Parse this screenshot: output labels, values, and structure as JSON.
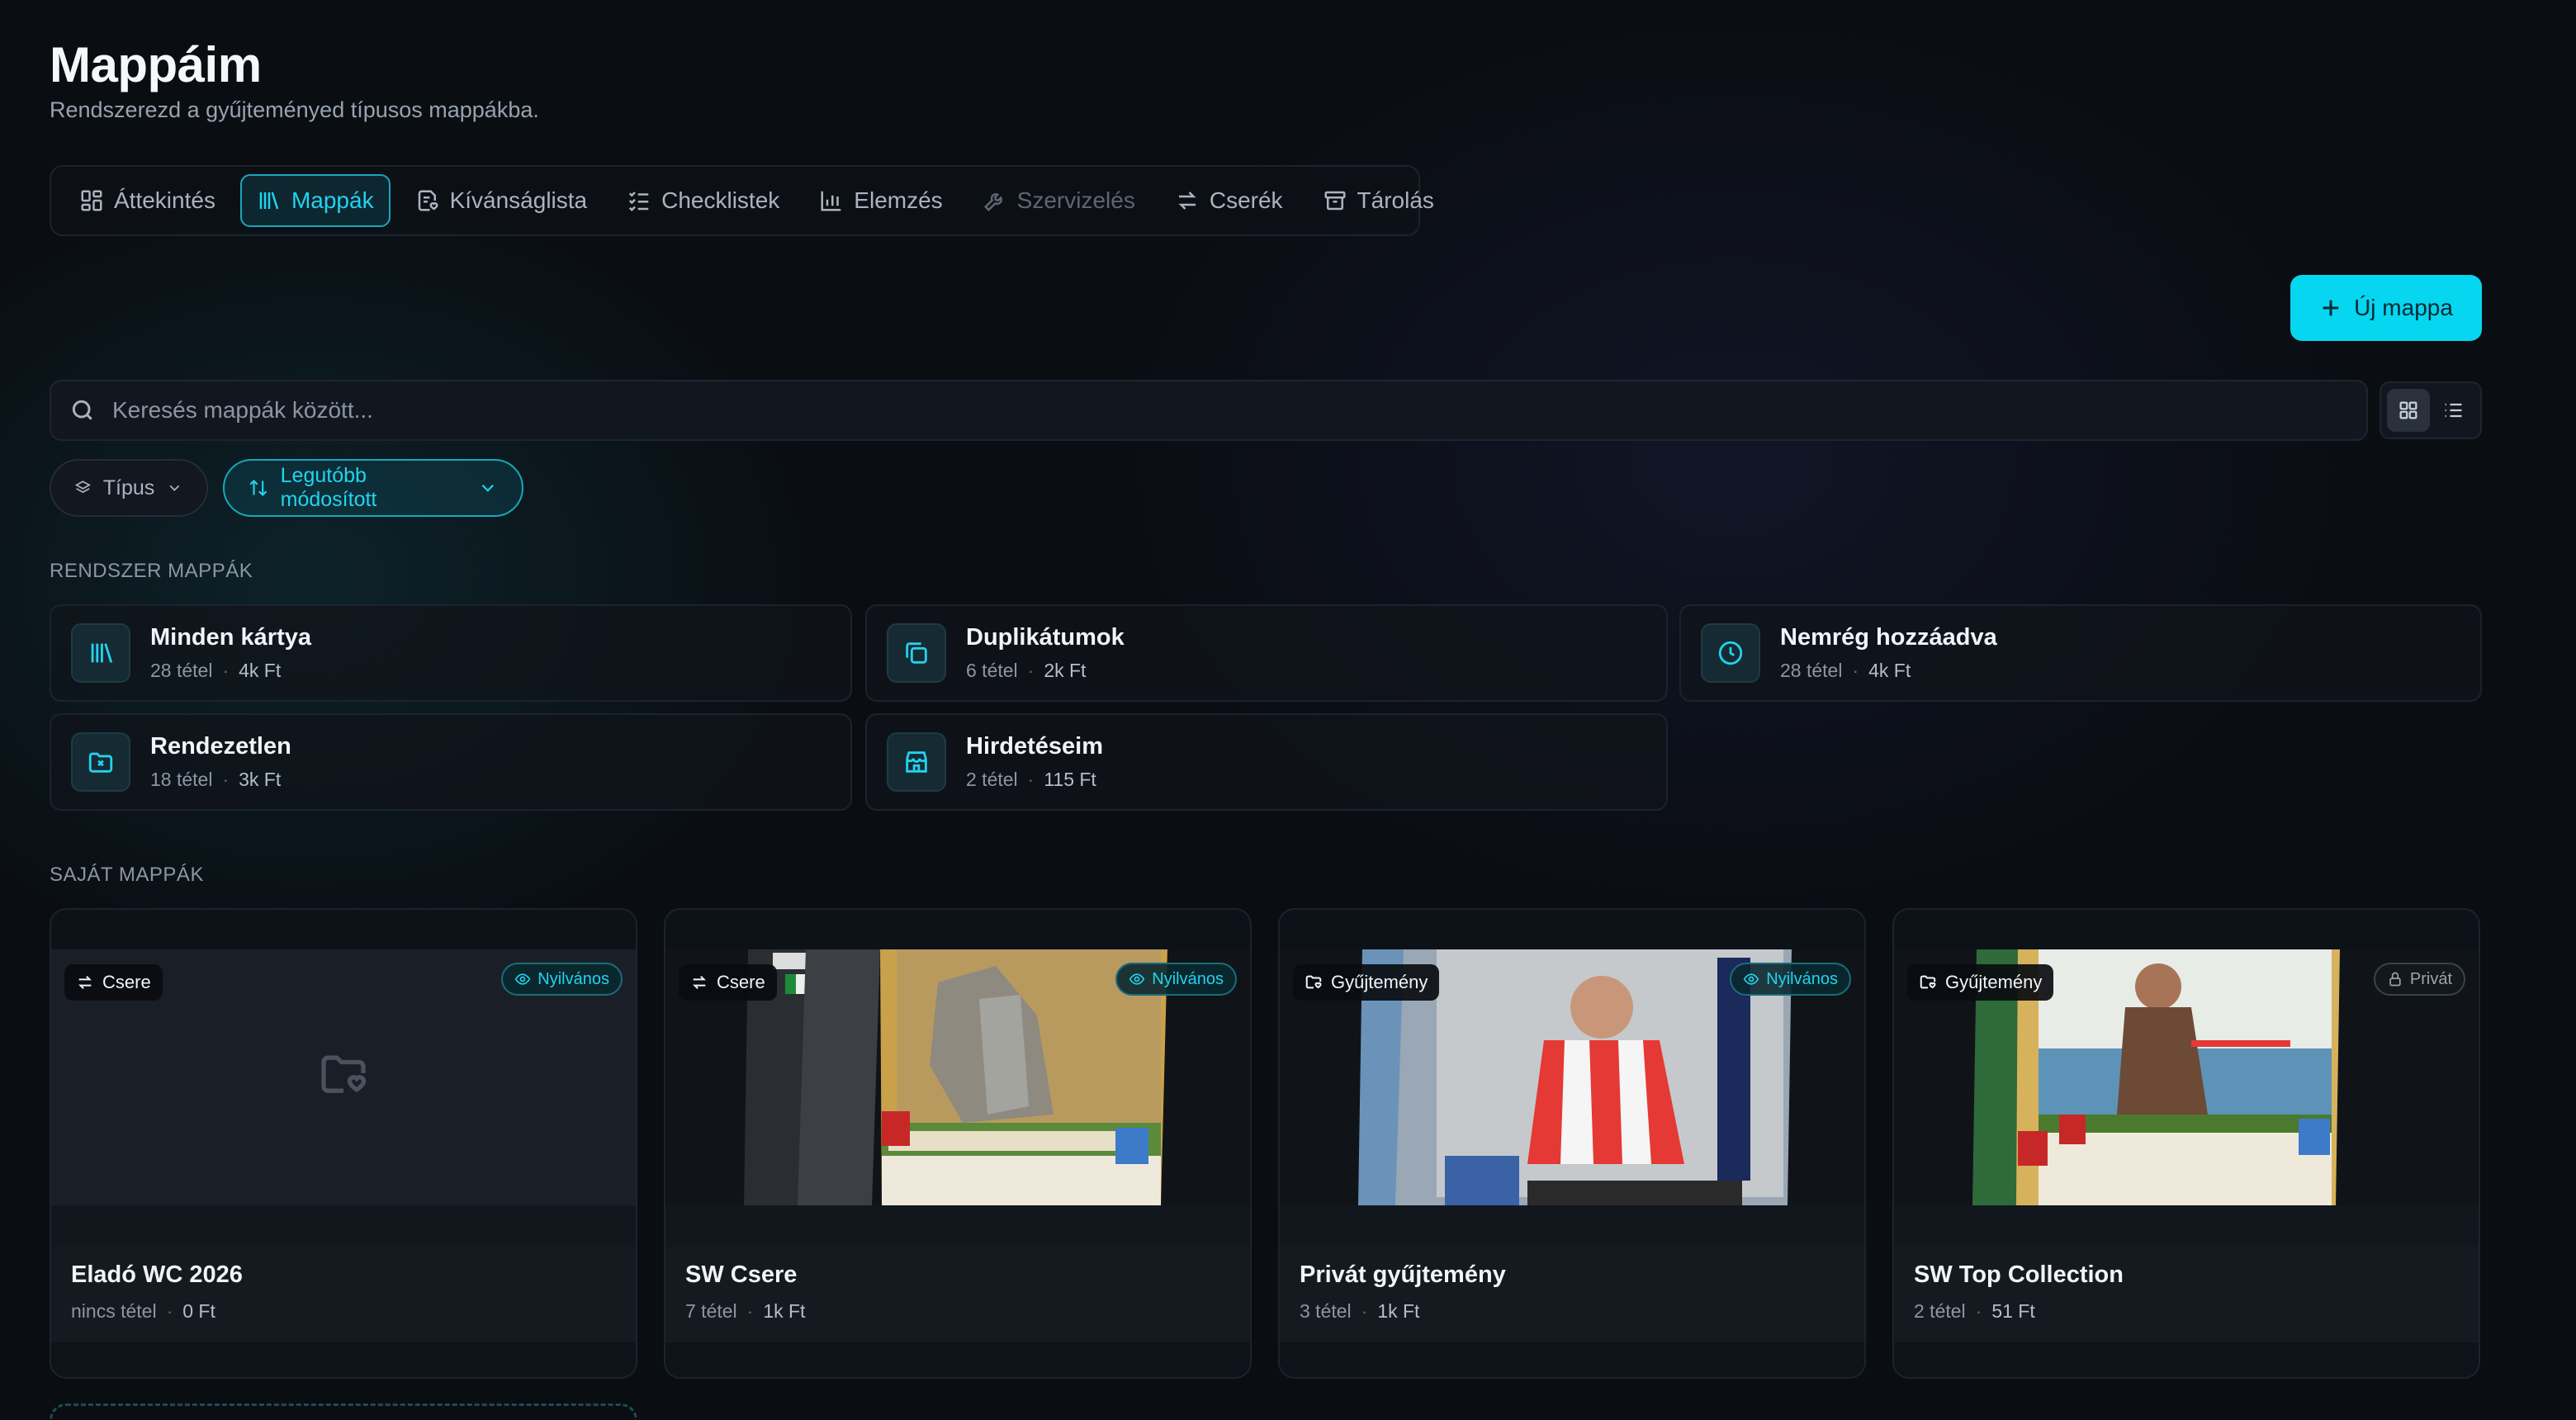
{
  "header": {
    "title": "Mappáim",
    "subtitle": "Rendszerezd a gyűjteményed típusos mappákba."
  },
  "tabs": [
    {
      "label": "Áttekintés",
      "icon": "dashboard-icon",
      "state": "normal"
    },
    {
      "label": "Mappák",
      "icon": "library-icon",
      "state": "active"
    },
    {
      "label": "Kívánságlista",
      "icon": "wishlist-icon",
      "state": "normal"
    },
    {
      "label": "Checklistek",
      "icon": "checklist-icon",
      "state": "normal"
    },
    {
      "label": "Elemzés",
      "icon": "bar-chart-icon",
      "state": "normal"
    },
    {
      "label": "Szervizelés",
      "icon": "wrench-icon",
      "state": "disabled"
    },
    {
      "label": "Cserék",
      "icon": "swap-icon",
      "state": "normal"
    },
    {
      "label": "Tárolás",
      "icon": "archive-icon",
      "state": "normal"
    }
  ],
  "actions": {
    "new_folder_label": "Új mappa"
  },
  "search": {
    "placeholder": "Keresés mappák között...",
    "value": ""
  },
  "filters": {
    "type_label": "Típus",
    "sort_label": "Legutóbb módosított"
  },
  "system_section": {
    "label": "RENDSZER MAPPÁK",
    "folders": [
      {
        "name": "Minden kártya",
        "count": "28 tétel",
        "value": "4k Ft",
        "icon": "library-icon"
      },
      {
        "name": "Duplikátumok",
        "count": "6 tétel",
        "value": "2k Ft",
        "icon": "copy-icon"
      },
      {
        "name": "Nemrég hozzáadva",
        "count": "28 tétel",
        "value": "4k Ft",
        "icon": "clock-icon"
      },
      {
        "name": "Rendezetlen",
        "count": "18 tétel",
        "value": "3k Ft",
        "icon": "folder-x-icon"
      },
      {
        "name": "Hirdetéseim",
        "count": "2 tétel",
        "value": "115 Ft",
        "icon": "store-icon"
      }
    ]
  },
  "own_section": {
    "label": "SAJÁT MAPPÁK",
    "folders": [
      {
        "name": "Eladó WC 2026",
        "type": "Csere",
        "type_icon": "swap-icon",
        "visibility": "Nyilvános",
        "count": "nincs tétel",
        "value": "0 Ft",
        "cover": "empty"
      },
      {
        "name": "SW Csere",
        "type": "Csere",
        "type_icon": "swap-icon",
        "visibility": "Nyilvános",
        "count": "7 tétel",
        "value": "1k Ft",
        "cover": "cards"
      },
      {
        "name": "Privát gyűjtemény",
        "type": "Gyűjtemény",
        "type_icon": "folder-heart-icon",
        "visibility": "Nyilvános",
        "count": "3 tétel",
        "value": "1k Ft",
        "cover": "cards"
      },
      {
        "name": "SW Top Collection",
        "type": "Gyűjtemény",
        "type_icon": "folder-heart-icon",
        "visibility": "Privát",
        "count": "2 tétel",
        "value": "51 Ft",
        "cover": "cards"
      }
    ]
  },
  "colors": {
    "accent": "#06d6ef",
    "background": "#0a0d12"
  }
}
